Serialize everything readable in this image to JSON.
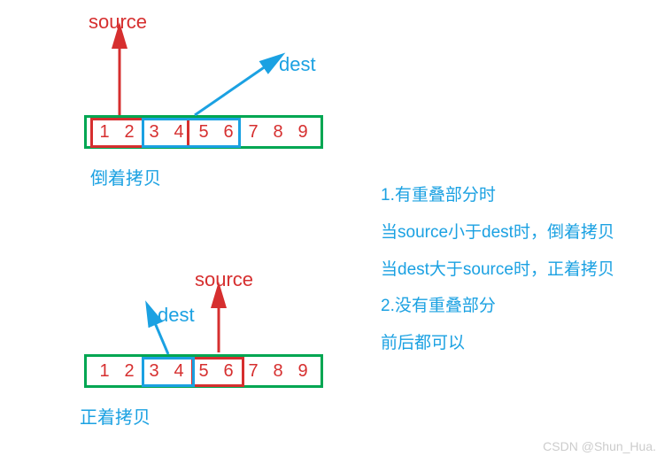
{
  "labels": {
    "source": "source",
    "dest": "dest"
  },
  "diagram1": {
    "cells": [
      "1",
      "2",
      "3",
      "4",
      "5",
      "6",
      "7",
      "8",
      "9"
    ],
    "caption": "倒着拷贝",
    "source_range": [
      0,
      3
    ],
    "dest_range": [
      2,
      5
    ]
  },
  "diagram2": {
    "cells": [
      "1",
      "2",
      "3",
      "4",
      "5",
      "6",
      "7",
      "8",
      "9"
    ],
    "caption": "正着拷贝",
    "source_range": [
      4,
      5
    ],
    "dest_range": [
      2,
      3
    ]
  },
  "explanation": {
    "line1": "1.有重叠部分时",
    "line2": "当source小于dest时，倒着拷贝",
    "line3": "当dest大于source时，正着拷贝",
    "line4": "2.没有重叠部分",
    "line5": "前后都可以"
  },
  "watermark": "CSDN @Shun_Hua."
}
